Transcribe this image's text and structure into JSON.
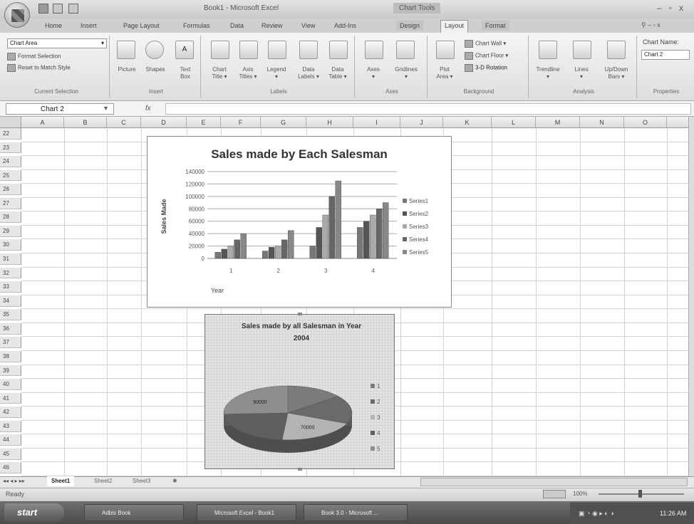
{
  "titlebar": {
    "title": "Book1 - Microsoft Excel",
    "context_tab": "Chart Tools",
    "controls": [
      "–",
      "▫",
      "x"
    ]
  },
  "tabs": [
    "Home",
    "Insert",
    "Page Layout",
    "Formulas",
    "Data",
    "Review",
    "View",
    "Add-Ins",
    "Design",
    "Layout",
    "Format"
  ],
  "ribbon": {
    "current_selection": {
      "dropdown": "Chart Area",
      "format_selection": "Format Selection",
      "reset": "Reset to Match Style",
      "group": "Current Selection"
    },
    "insert": {
      "picture": "Picture",
      "shapes": "Shapes",
      "text_box": "Text\nBox",
      "group": "Insert"
    },
    "labels": {
      "chart_title": "Chart\nTitle ▾",
      "axis_titles": "Axis\nTitles ▾",
      "legend": "Legend\n▾",
      "data_labels": "Data\nLabels ▾",
      "data_table": "Data\nTable ▾",
      "group": "Labels"
    },
    "axes": {
      "axes": "Axes\n▾",
      "gridlines": "Gridlines\n▾",
      "group": "Axes"
    },
    "background": {
      "plot_area": "Plot\nArea ▾",
      "chart_wall": "Chart Wall ▾",
      "chart_floor": "Chart Floor ▾",
      "rotation": "3-D Rotation",
      "group": "Background"
    },
    "analysis": {
      "trendline": "Trendline\n▾",
      "lines": "Lines\n▾",
      "updown_bars": "Up/Down\nBars ▾",
      "group": "Analysis"
    },
    "properties": {
      "chart_name_label": "Chart Name:",
      "chart_name": "Chart 2",
      "group": "Properties"
    }
  },
  "formula_bar": {
    "name_box": "Chart 2",
    "fx": "fx",
    "value": ""
  },
  "columns": [
    "A",
    "B",
    "C",
    "D",
    "E",
    "F",
    "G",
    "H",
    "I",
    "J",
    "K",
    "L",
    "M",
    "N",
    "O"
  ],
  "rows": [
    "22",
    "23",
    "24",
    "25",
    "26",
    "27",
    "28",
    "29",
    "30",
    "31",
    "32",
    "33",
    "34",
    "35",
    "36",
    "37",
    "38",
    "39",
    "40",
    "41",
    "42",
    "43",
    "44",
    "45",
    "46"
  ],
  "chart_data": [
    {
      "type": "bar",
      "title": "Sales made by Each Salesman",
      "xlabel": "Year",
      "ylabel": "Sales Made",
      "categories": [
        "1",
        "2",
        "3",
        "4"
      ],
      "yticks": [
        "0",
        "20000",
        "40000",
        "60000",
        "80000",
        "100000",
        "120000",
        "140000"
      ],
      "ylim": [
        0,
        140000
      ],
      "grid": true,
      "legend_position": "right",
      "series": [
        {
          "name": "Series1",
          "values": [
            10000,
            12000,
            20000,
            50000
          ],
          "color": "#777777"
        },
        {
          "name": "Series2",
          "values": [
            15000,
            18000,
            50000,
            60000
          ],
          "color": "#555555"
        },
        {
          "name": "Series3",
          "values": [
            20000,
            20000,
            70000,
            70000
          ],
          "color": "#aaaaaa"
        },
        {
          "name": "Series4",
          "values": [
            30000,
            30000,
            100000,
            80000
          ],
          "color": "#666666"
        },
        {
          "name": "Series5",
          "values": [
            40000,
            45000,
            125000,
            90000
          ],
          "color": "#888888"
        }
      ]
    },
    {
      "type": "pie",
      "title": "Sales made by all Salesman in Year 2004",
      "legend_position": "right",
      "labels": [
        "1",
        "2",
        "3",
        "4",
        "5"
      ],
      "values": [
        50000,
        60000,
        70000,
        80000,
        90000
      ],
      "data_labels": [
        "",
        "",
        "70000",
        "",
        "90000"
      ],
      "colors": [
        "#7c7c7c",
        "#6a6a6a",
        "#b3b3b3",
        "#5f5f5f",
        "#8e8e8e"
      ]
    }
  ],
  "sheet_tabs": [
    "Sheet1",
    "Sheet2",
    "Sheet3"
  ],
  "status": {
    "ready": "Ready",
    "zoom": "100%"
  },
  "taskbar": {
    "start": "start",
    "tasks": [
      "Adbis Book",
      "Microsoft Excel - Book1",
      "Book 3.0 - Microsoft ..."
    ],
    "clock": "11:26 AM"
  }
}
